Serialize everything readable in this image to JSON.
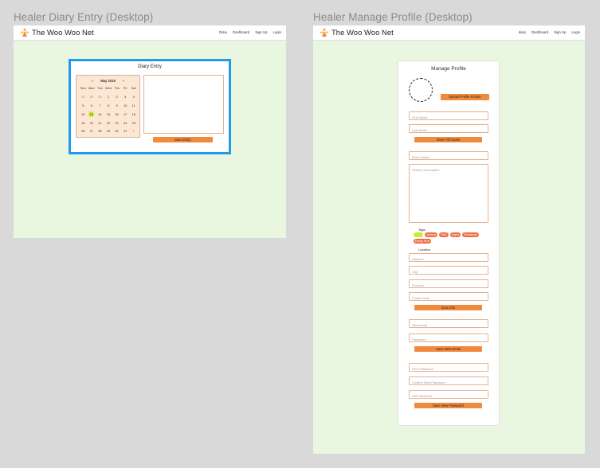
{
  "diary_frame": {
    "label": "Healer Diary Entry (Desktop)",
    "brand": "The Woo Woo Net",
    "nav": [
      "Diary",
      "Dashboard",
      "Sign Up",
      "Login"
    ],
    "card_title": "Diary Entry",
    "calendar": {
      "prev": "«",
      "month_year": "May 2019",
      "next": "»",
      "weekdays": [
        "Sun",
        "Mon",
        "Tue",
        "Wed",
        "Thu",
        "Fri",
        "Sat"
      ],
      "days": [
        {
          "d": "28",
          "muted": true
        },
        {
          "d": "29",
          "muted": true
        },
        {
          "d": "30",
          "muted": true
        },
        {
          "d": "1"
        },
        {
          "d": "2"
        },
        {
          "d": "3"
        },
        {
          "d": "4"
        },
        {
          "d": "5"
        },
        {
          "d": "6"
        },
        {
          "d": "7"
        },
        {
          "d": "8"
        },
        {
          "d": "9"
        },
        {
          "d": "10"
        },
        {
          "d": "11"
        },
        {
          "d": "12"
        },
        {
          "d": "13",
          "selected": true
        },
        {
          "d": "14"
        },
        {
          "d": "15"
        },
        {
          "d": "16"
        },
        {
          "d": "17"
        },
        {
          "d": "18"
        },
        {
          "d": "19"
        },
        {
          "d": "20"
        },
        {
          "d": "21"
        },
        {
          "d": "22"
        },
        {
          "d": "23"
        },
        {
          "d": "24"
        },
        {
          "d": "25"
        },
        {
          "d": "26"
        },
        {
          "d": "27"
        },
        {
          "d": "28"
        },
        {
          "d": "29"
        },
        {
          "d": "30"
        },
        {
          "d": "31"
        },
        {
          "d": "1",
          "muted": true
        }
      ]
    },
    "entry_placeholder": "...",
    "save_label": "Save Entry"
  },
  "profile_frame": {
    "label": "Healer Manage Profile (Desktop)",
    "brand": "The Woo Woo Net",
    "nav": [
      "diary",
      "Dashboard",
      "Sign Up",
      "Login"
    ],
    "card_title": "Manage Profile",
    "upload_label": "Upload Profile Picture",
    "first_name_placeholder": "First Name",
    "last_name_placeholder": "Last Name",
    "save_full_name_label": "Save Full Name",
    "brand_name_placeholder": "Brand Name",
    "service_description_placeholder": "Service Description",
    "tags_label": "Tags",
    "tags": [
      {
        "label": "",
        "active": true
      },
      {
        "label": "Ancestry"
      },
      {
        "label": "Reiki"
      },
      {
        "label": "Angels"
      },
      {
        "label": "Shamanism"
      },
      {
        "label": "Energy Work"
      }
    ],
    "location_label": "Location",
    "address_placeholder": "Address",
    "city_placeholder": "City",
    "province_placeholder": "Province",
    "postal_code_placeholder": "Postal Code",
    "save_info_label": "Save Info",
    "new_email_placeholder": "New Email",
    "password_placeholder": "Password",
    "save_new_email_label": "Save New Email",
    "new_password_placeholder": "New Password",
    "confirm_password_placeholder": "Confirm New Password",
    "old_password_placeholder": "Old Password",
    "save_new_password_label": "Save New Password"
  },
  "colors": {
    "page_bg": "#d9d9d9",
    "frame_bg": "#e9f7e0",
    "accent": "#f28a3d",
    "selection_outline": "#1e9bef",
    "highlight": "#c9ec2f"
  },
  "icons": [
    "angel-logo-icon"
  ]
}
